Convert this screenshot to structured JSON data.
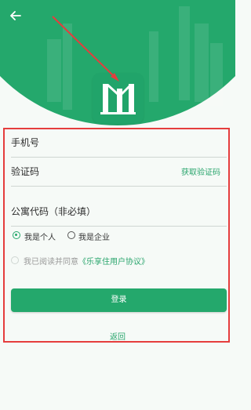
{
  "header": {
    "back_icon": "arrow-left-icon",
    "logo_icon": "building-logo-icon"
  },
  "form": {
    "phone_label": "手机号",
    "code_label": "验证码",
    "get_code_label": "获取验证码",
    "apartment_code_label": "公寓代码（非必填）",
    "user_type": {
      "options": [
        "我是个人",
        "我是企业"
      ],
      "selected": "我是个人"
    },
    "agreement_prefix": "我已阅读并同意",
    "agreement_link": "《乐享住用户协议》",
    "login_label": "登录",
    "return_label": "返回"
  },
  "colors": {
    "brand": "#24a86c",
    "annotation": "#e53d3d"
  }
}
